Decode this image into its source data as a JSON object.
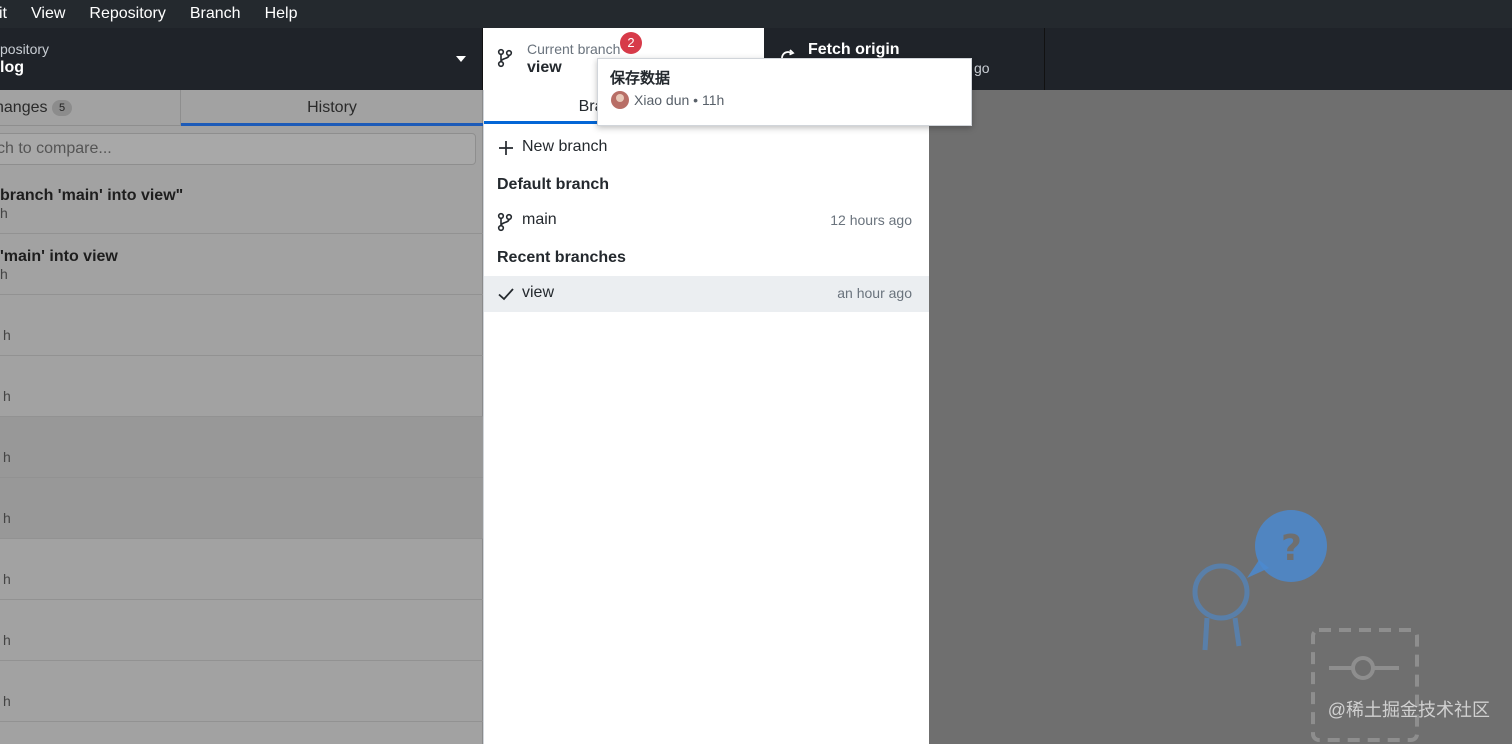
{
  "menu": [
    "it",
    "View",
    "Repository",
    "Branch",
    "Help"
  ],
  "toolbar": {
    "repo_sub": "pository",
    "repo_name": "log",
    "branch_sub": "Current branch",
    "branch_name": "view",
    "badge_count": "2",
    "fetch_label": "Fetch origin",
    "fetch_time_fragment": "go"
  },
  "tooltip": {
    "title": "保存数据",
    "meta": "Xiao dun • 11h"
  },
  "left": {
    "tab_changes": "hanges",
    "changes_count": "5",
    "tab_history": "History",
    "search_placeholder": "ch to compare...",
    "commits": [
      {
        "title": " branch 'main' into view\"",
        "sub": "h"
      },
      {
        "title": "'main' into view",
        "sub": "h"
      },
      {
        "title": "",
        "sub": "h"
      },
      {
        "title": "",
        "sub": "h"
      },
      {
        "title": "",
        "sub": "h"
      },
      {
        "title": "",
        "sub": "h"
      },
      {
        "title": "",
        "sub": "h"
      },
      {
        "title": "",
        "sub": "h"
      },
      {
        "title": "",
        "sub": "h"
      }
    ]
  },
  "dropdown": {
    "tab_branches": "Bran",
    "new_branch": "New branch",
    "default_header": "Default branch",
    "default_branch": {
      "name": "main",
      "time": "12 hours ago"
    },
    "recent_header": "Recent branches",
    "recent_branch": {
      "name": "view",
      "time": "an hour ago"
    }
  },
  "watermark": "@稀土掘金技术社区"
}
